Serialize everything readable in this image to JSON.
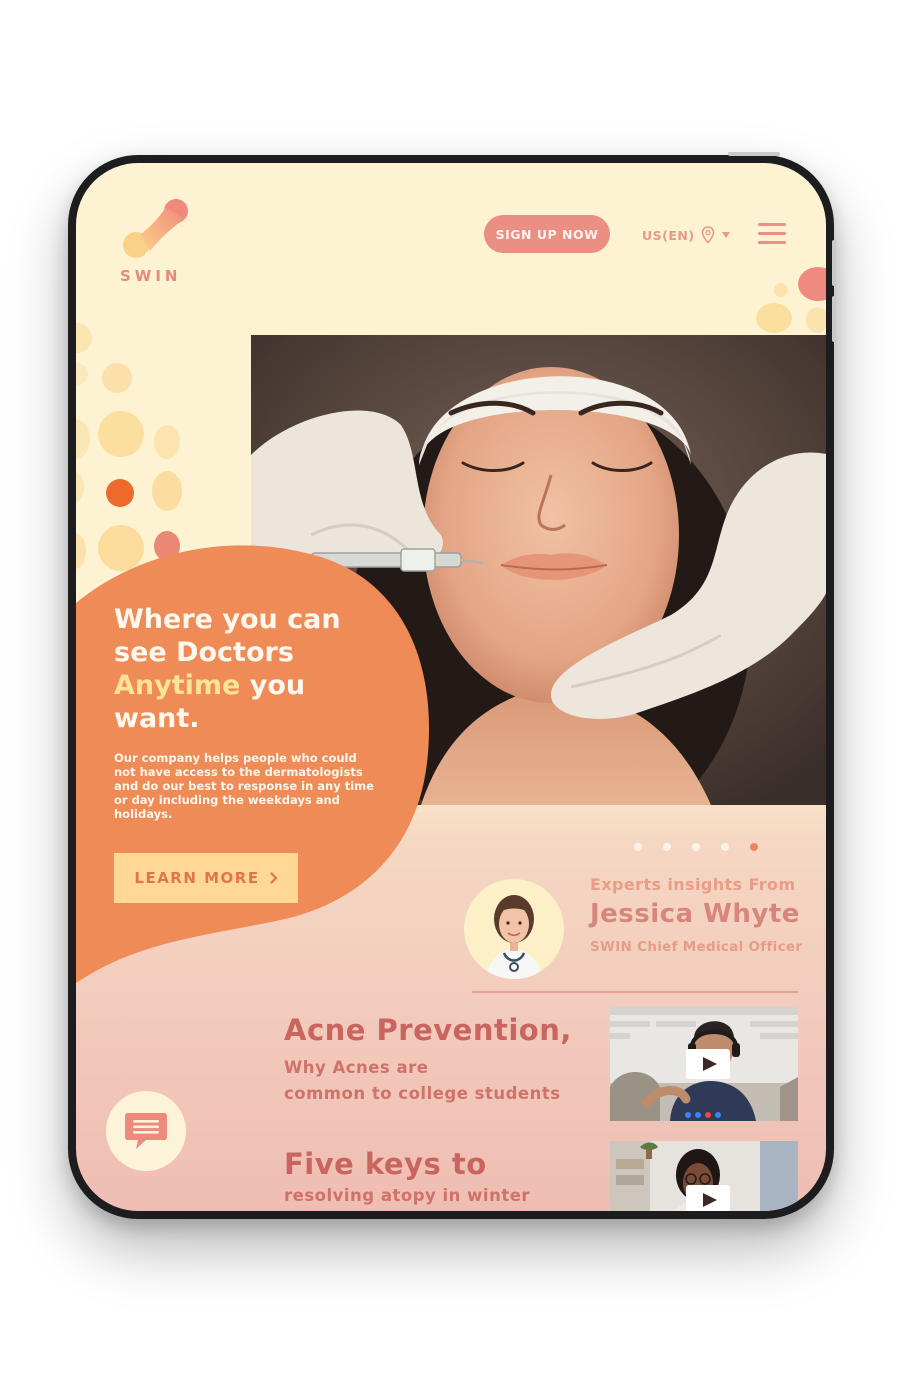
{
  "brand": {
    "name": "SWIN"
  },
  "header": {
    "signup_label": "SIGN UP NOW",
    "locale_label": "US(EN)"
  },
  "hero": {
    "headline_line1": "Where you can",
    "headline_line2": "see Doctors",
    "headline_accent": "Anytime",
    "headline_line3_rest": " you",
    "headline_line4": "want.",
    "body": "Our company helps people who could not have access to the dermatologists and do our best to response in any time or day including the weekdays and holidays.",
    "cta_label": "LEARN MORE",
    "cta_icon": "chevron-right-icon",
    "carousel": {
      "count": 5,
      "active_index": 4
    }
  },
  "expert": {
    "pre_label": "Experts insights From",
    "name": "Jessica Whyte",
    "role": "SWIN Chief Medical Officer"
  },
  "articles": [
    {
      "title": "Acne Prevention,",
      "subtitle_line1": "Why Acnes are",
      "subtitle_line2": "common to college students"
    },
    {
      "title": "Five keys to",
      "subtitle_line1": "resolving atopy in winter"
    }
  ],
  "colors": {
    "background_top": "#fdf3d3",
    "background_bottom": "#efbdb3",
    "hero_orange": "#ee8b56",
    "accent_yellow": "#fde29a",
    "button_pink": "#eb8f85",
    "heading_rose": "#c9645f"
  }
}
